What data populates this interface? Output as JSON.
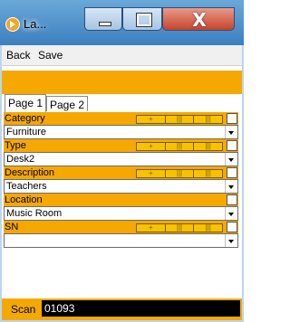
{
  "window": {
    "title": "La...",
    "close_glyph": "X"
  },
  "menu": {
    "back": "Back",
    "save": "Save"
  },
  "tabs": [
    {
      "label": "Page 1"
    },
    {
      "label": "Page 2"
    }
  ],
  "mini_buttons": [
    "+",
    "|||",
    "|||"
  ],
  "fields": [
    {
      "label": "Category",
      "value": "Furniture"
    },
    {
      "label": "Type",
      "value": "Desk2"
    },
    {
      "label": "Description",
      "value": "Teachers"
    },
    {
      "label": "Location",
      "value": "Music  Room"
    },
    {
      "label": "SN",
      "value": ""
    }
  ],
  "scan": {
    "label": "Scan",
    "value": "01093"
  },
  "colors": {
    "accent": "#f5a800",
    "titlebar": "#3c7fc0",
    "close": "#c7432b"
  }
}
